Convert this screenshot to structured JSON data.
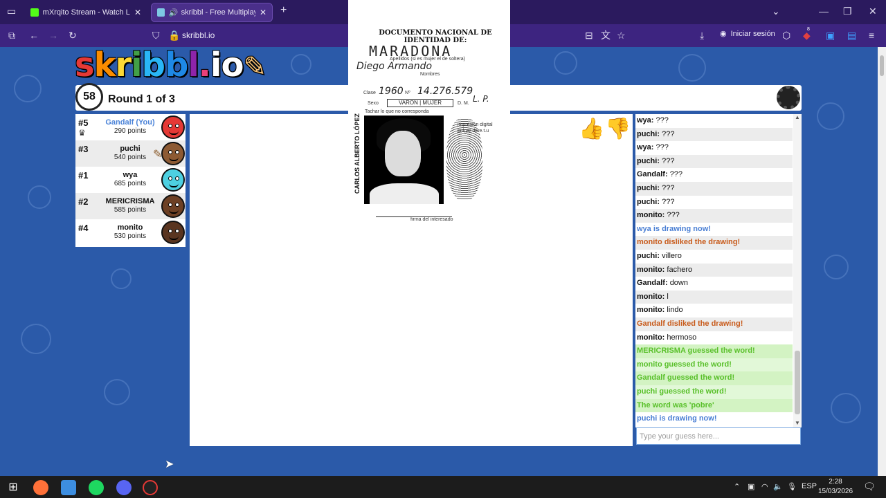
{
  "browser": {
    "tabs": [
      {
        "label": "mXrqito Stream - Watch Live on",
        "close": "✕"
      },
      {
        "label": "skribbl - Free Multiplayer D",
        "close": "✕"
      }
    ],
    "new_tab": "+",
    "url": "skribbl.io",
    "signin_label": "Iniciar sesión",
    "badge_count": "8"
  },
  "game": {
    "logo": "skribbl.io",
    "timer": "58",
    "round_label": "Round 1 of 3"
  },
  "players": [
    {
      "rank": "#5",
      "name": "Gandalf (You)",
      "points": "290 points",
      "color": "#e53935"
    },
    {
      "rank": "#3",
      "name": "puchi",
      "points": "540 points",
      "color": "#8d5a33"
    },
    {
      "rank": "#1",
      "name": "wya",
      "points": "685 points",
      "color": "#4dd0e1"
    },
    {
      "rank": "#2",
      "name": "MERICRISMA",
      "points": "585 points",
      "color": "#6d4024"
    },
    {
      "rank": "#4",
      "name": "monito",
      "points": "530 points",
      "color": "#5a3520"
    }
  ],
  "document": {
    "title": "DOCUMENTO NACIONAL DE IDENTIDAD DE:",
    "surname": "MARADONA",
    "surname_hint": "Apellidos (si es mujer el de soltera)",
    "given_names": "Diego Armando",
    "names_hint": "Nombres",
    "clase_label": "Clase",
    "clase_value": "1960",
    "number_label": "Nº",
    "number_value": "14.276.579",
    "sex_label": "Sexo",
    "sex_options": "VARON | MUJER",
    "district": "D. M.",
    "district_value": "L. P.",
    "tachar_hint": "Tachar lo que no corresponda",
    "fingerprint_label": "impresión digital pulgar dere.t.u",
    "signature_label": "firma del interesado",
    "vertical_name": "CARLOS ALBERTO LÓPEZ"
  },
  "chat": {
    "messages": [
      {
        "user": "wya",
        "text": "???",
        "type": "normal"
      },
      {
        "user": "puchi",
        "text": "???",
        "type": "normal"
      },
      {
        "user": "wya",
        "text": "???",
        "type": "normal"
      },
      {
        "user": "puchi",
        "text": "???",
        "type": "normal"
      },
      {
        "user": "Gandalf",
        "text": "???",
        "type": "normal"
      },
      {
        "user": "puchi",
        "text": "???",
        "type": "normal"
      },
      {
        "user": "puchi",
        "text": "???",
        "type": "normal"
      },
      {
        "user": "monito",
        "text": "???",
        "type": "normal"
      },
      {
        "user": "",
        "text": "wya is drawing now!",
        "type": "sys-blue"
      },
      {
        "user": "",
        "text": "monito disliked the drawing!",
        "type": "sys-orange"
      },
      {
        "user": "puchi",
        "text": "villero",
        "type": "normal"
      },
      {
        "user": "monito",
        "text": "fachero",
        "type": "normal"
      },
      {
        "user": "Gandalf",
        "text": "down",
        "type": "normal"
      },
      {
        "user": "monito",
        "text": "l",
        "type": "normal"
      },
      {
        "user": "monito",
        "text": "lindo",
        "type": "normal"
      },
      {
        "user": "",
        "text": "Gandalf disliked the drawing!",
        "type": "sys-orange"
      },
      {
        "user": "monito",
        "text": "hermoso",
        "type": "normal"
      },
      {
        "user": "",
        "text": "MERICRISMA guessed the word!",
        "type": "sys-green"
      },
      {
        "user": "",
        "text": "monito guessed the word!",
        "type": "sys-green"
      },
      {
        "user": "",
        "text": "Gandalf guessed the word!",
        "type": "sys-green"
      },
      {
        "user": "",
        "text": "puchi guessed the word!",
        "type": "sys-green"
      },
      {
        "user": "",
        "text": "The word was 'pobre'",
        "type": "sys-green"
      },
      {
        "user": "",
        "text": "puchi is drawing now!",
        "type": "sys-blue"
      }
    ],
    "input_placeholder": "Type your guess here..."
  },
  "taskbar": {
    "language": "ESP",
    "time": "2:28",
    "date": "15/03/2026"
  }
}
